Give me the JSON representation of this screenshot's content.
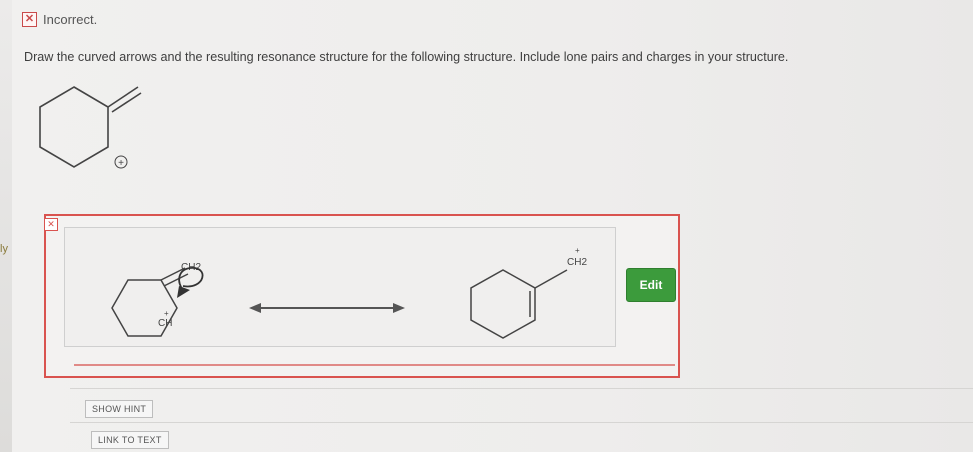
{
  "status": {
    "text": "Incorrect.",
    "icon": "x-mark-icon"
  },
  "question": {
    "prompt": "Draw the curved arrows and the resulting resonance structure for the following structure. Include lone pairs and charges in your structure.",
    "plus_label": "+"
  },
  "side_label": "ly",
  "answer": {
    "left_ch2_label": "CH2",
    "left_ch_label": "CH",
    "left_charge": "+",
    "right_label": "CH2",
    "right_charge": "+",
    "edit_label": "Edit"
  },
  "buttons": {
    "hint": "SHOW HINT",
    "link": "LINK TO TEXT"
  },
  "colors": {
    "error": "#d9534f",
    "edit": "#3c9b3c"
  }
}
